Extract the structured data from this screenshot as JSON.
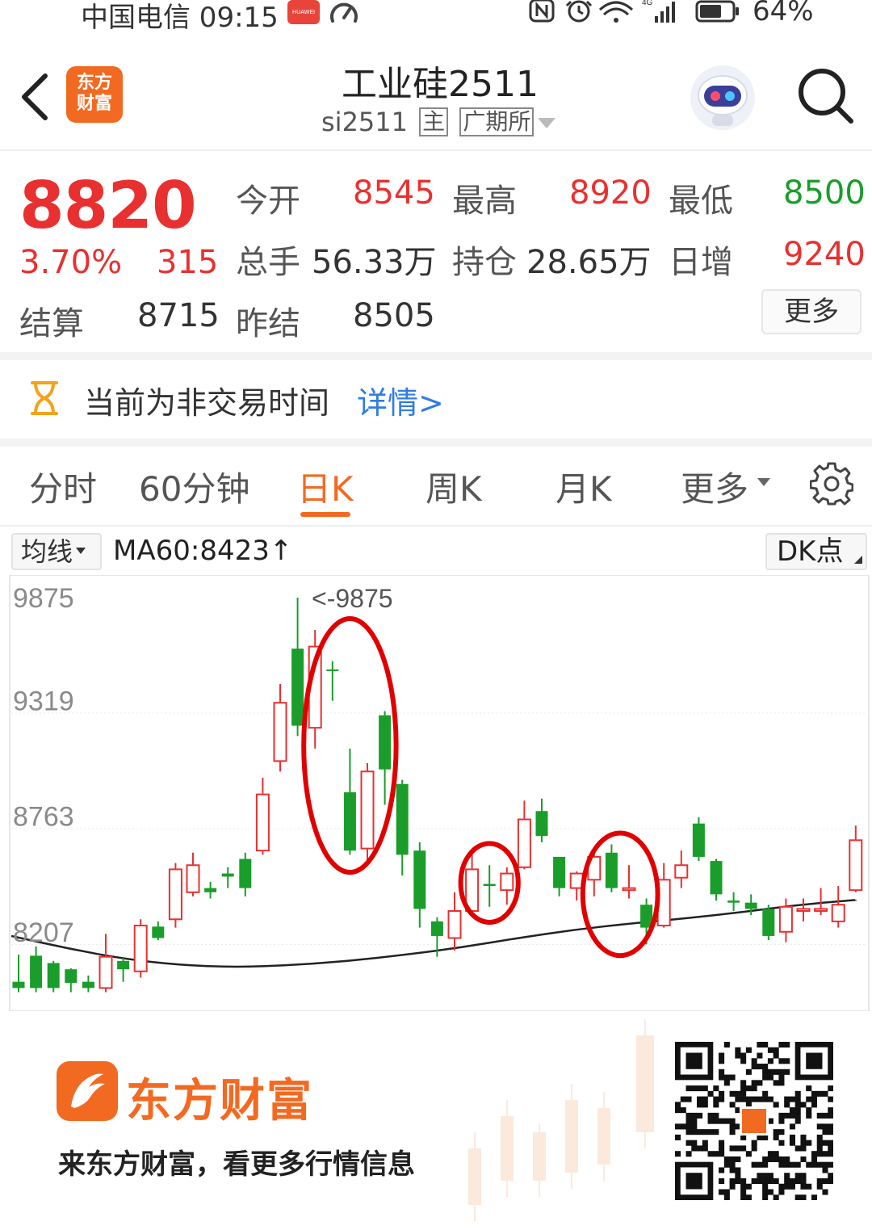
{
  "status_bar": {
    "carrier_time": "中国电信 09:15",
    "huawei_badge": "HUAWEI",
    "battery": "64%"
  },
  "header": {
    "logo_line1": "东方",
    "logo_line2": "财富",
    "title": "工业硅2511",
    "code": "si2511",
    "tag_main": "主",
    "tag_exchange": "广期所"
  },
  "quote": {
    "price": "8820",
    "change_pct": "3.70%",
    "change_abs": "315",
    "open_label": "今开",
    "open_value": "8545",
    "high_label": "最高",
    "high_value": "8920",
    "low_label": "最低",
    "low_value": "8500",
    "volume_label": "总手",
    "volume_value": "56.33万",
    "oi_label": "持仓",
    "oi_value": "28.65万",
    "daily_inc_label": "日增",
    "daily_inc_value": "9240",
    "settle_label": "结算",
    "settle_value": "8715",
    "prev_settle_label": "昨结",
    "prev_settle_value": "8505",
    "more_button": "更多"
  },
  "notice": {
    "text": "当前为非交易时间",
    "link": "详情>"
  },
  "tabs": [
    {
      "label": "分时"
    },
    {
      "label": "60分钟"
    },
    {
      "label": "日K"
    },
    {
      "label": "周K"
    },
    {
      "label": "月K"
    },
    {
      "label": "更多"
    }
  ],
  "indicator": {
    "select_label": "均线",
    "ma_text": "MA60:8423↑",
    "dk_button": "DK点"
  },
  "chart_data": {
    "type": "candlestick",
    "y_ticks": [
      "9875",
      "9319",
      "8763",
      "8207"
    ],
    "max_marker": "<-9875",
    "ylim": [
      8000,
      9875
    ],
    "colors": {
      "up": "#e93030",
      "down": "#1a9d2a",
      "ma": "#222222",
      "circle": "#e00000"
    },
    "candles": [
      [
        8030,
        8000,
        8160,
        7980
      ],
      [
        8155,
        8000,
        8200,
        7980
      ],
      [
        8120,
        8000,
        8130,
        7980
      ],
      [
        8090,
        8025,
        8095,
        7980
      ],
      [
        8030,
        8000,
        8060,
        7980
      ],
      [
        8000,
        8150,
        8260,
        7980
      ],
      [
        8130,
        8090,
        8145,
        8030
      ],
      [
        8080,
        8300,
        8330,
        8050
      ],
      [
        8295,
        8240,
        8320,
        8230
      ],
      [
        8330,
        8570,
        8600,
        8290
      ],
      [
        8460,
        8590,
        8650,
        8440
      ],
      [
        8480,
        8460,
        8510,
        8430
      ],
      [
        8550,
        8535,
        8580,
        8480
      ],
      [
        8620,
        8480,
        8650,
        8440
      ],
      [
        8660,
        8930,
        9010,
        8640
      ],
      [
        9090,
        9370,
        9460,
        9040
      ],
      [
        9630,
        9260,
        9875,
        9210
      ],
      [
        9250,
        9640,
        9720,
        9150
      ],
      [
        9530,
        9525,
        9570,
        9380
      ],
      [
        8940,
        8660,
        9150,
        8640
      ],
      [
        8670,
        9040,
        9080,
        8610
      ],
      [
        9310,
        9050,
        9330,
        8880
      ],
      [
        8980,
        8640,
        9000,
        8540
      ],
      [
        8660,
        8380,
        8700,
        8290
      ],
      [
        8320,
        8250,
        8340,
        8150
      ],
      [
        8240,
        8370,
        8460,
        8180
      ],
      [
        8370,
        8570,
        8640,
        8370
      ],
      [
        8500,
        8490,
        8590,
        8390
      ],
      [
        8470,
        8550,
        8580,
        8400
      ],
      [
        8580,
        8810,
        8900,
        8570
      ],
      [
        8850,
        8730,
        8910,
        8700
      ],
      [
        8630,
        8480,
        8630,
        8440
      ],
      [
        8480,
        8550,
        8560,
        8420
      ],
      [
        8520,
        8630,
        8650,
        8440
      ],
      [
        8650,
        8480,
        8690,
        8460
      ],
      [
        8470,
        8480,
        8590,
        8430
      ],
      [
        8400,
        8290,
        8430,
        8210
      ],
      [
        8300,
        8520,
        8600,
        8290
      ],
      [
        8530,
        8590,
        8660,
        8480
      ],
      [
        8790,
        8630,
        8820,
        8610
      ],
      [
        8610,
        8450,
        8620,
        8420
      ],
      [
        8420,
        8410,
        8460,
        8370
      ],
      [
        8410,
        8380,
        8450,
        8350
      ],
      [
        8380,
        8250,
        8400,
        8230
      ],
      [
        8270,
        8390,
        8430,
        8220
      ],
      [
        8370,
        8380,
        8430,
        8320
      ],
      [
        8370,
        8380,
        8480,
        8350
      ],
      [
        8320,
        8400,
        8490,
        8290
      ],
      [
        8470,
        8710,
        8780,
        8460
      ]
    ],
    "ma_curve": [
      8250,
      8190,
      8140,
      8110,
      8100,
      8110,
      8130,
      8160,
      8195,
      8240,
      8280,
      8310,
      8335,
      8365,
      8400,
      8423
    ],
    "circle_groups": [
      [
        17,
        21
      ],
      [
        26,
        28
      ],
      [
        33,
        36
      ]
    ]
  },
  "footer": {
    "brand": "东方财富",
    "slogan": "来东方财富，看更多行情信息"
  }
}
